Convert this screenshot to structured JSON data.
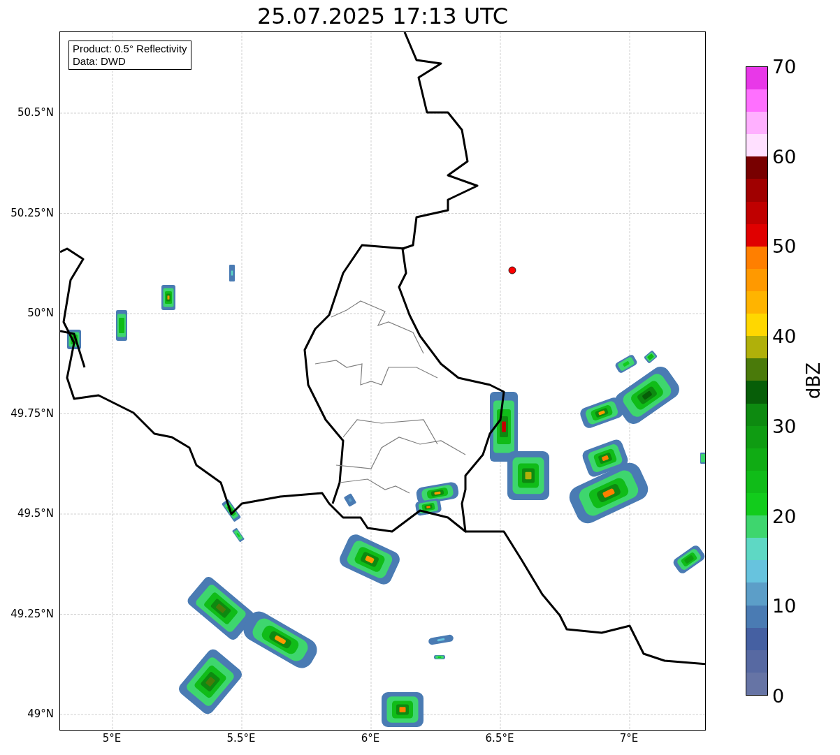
{
  "title": "25.07.2025 17:13 UTC",
  "legend": {
    "lines": [
      "Product: 0.5° Reflectivity",
      "Data: DWD"
    ]
  },
  "map": {
    "yticks": [
      "50.5°N",
      "50.25°N",
      "50°N",
      "49.75°N",
      "49.5°N",
      "49.25°N",
      "49°N"
    ],
    "xticks": [
      "5°E",
      "5.5°E",
      "6°E",
      "6.5°E",
      "7°E"
    ]
  },
  "colorbar": {
    "label": "dBZ",
    "ticks": [
      "70",
      "60",
      "50",
      "40",
      "30",
      "20",
      "10",
      "0"
    ],
    "segments": [
      {
        "color": "#6674a5"
      },
      {
        "color": "#5769a2"
      },
      {
        "color": "#4560a2"
      },
      {
        "color": "#4a7bb3"
      },
      {
        "color": "#5c9ec8"
      },
      {
        "color": "#67c3de"
      },
      {
        "color": "#5ed8c4"
      },
      {
        "color": "#3ed66e"
      },
      {
        "color": "#12cc1c"
      },
      {
        "color": "#10bc18"
      },
      {
        "color": "#10ac14"
      },
      {
        "color": "#0f9c12"
      },
      {
        "color": "#0d8a10"
      },
      {
        "color": "#075e08"
      },
      {
        "color": "#4a7a0a"
      },
      {
        "color": "#b0b00a"
      },
      {
        "color": "#ffd700"
      },
      {
        "color": "#ffb400"
      },
      {
        "color": "#ff9900"
      },
      {
        "color": "#ff7f00"
      },
      {
        "color": "#e00000"
      },
      {
        "color": "#c00000"
      },
      {
        "color": "#a00000"
      },
      {
        "color": "#780000"
      },
      {
        "color": "#ffe0ff"
      },
      {
        "color": "#ffb0ff"
      },
      {
        "color": "#ff70ff"
      },
      {
        "color": "#e838e8"
      }
    ]
  }
}
